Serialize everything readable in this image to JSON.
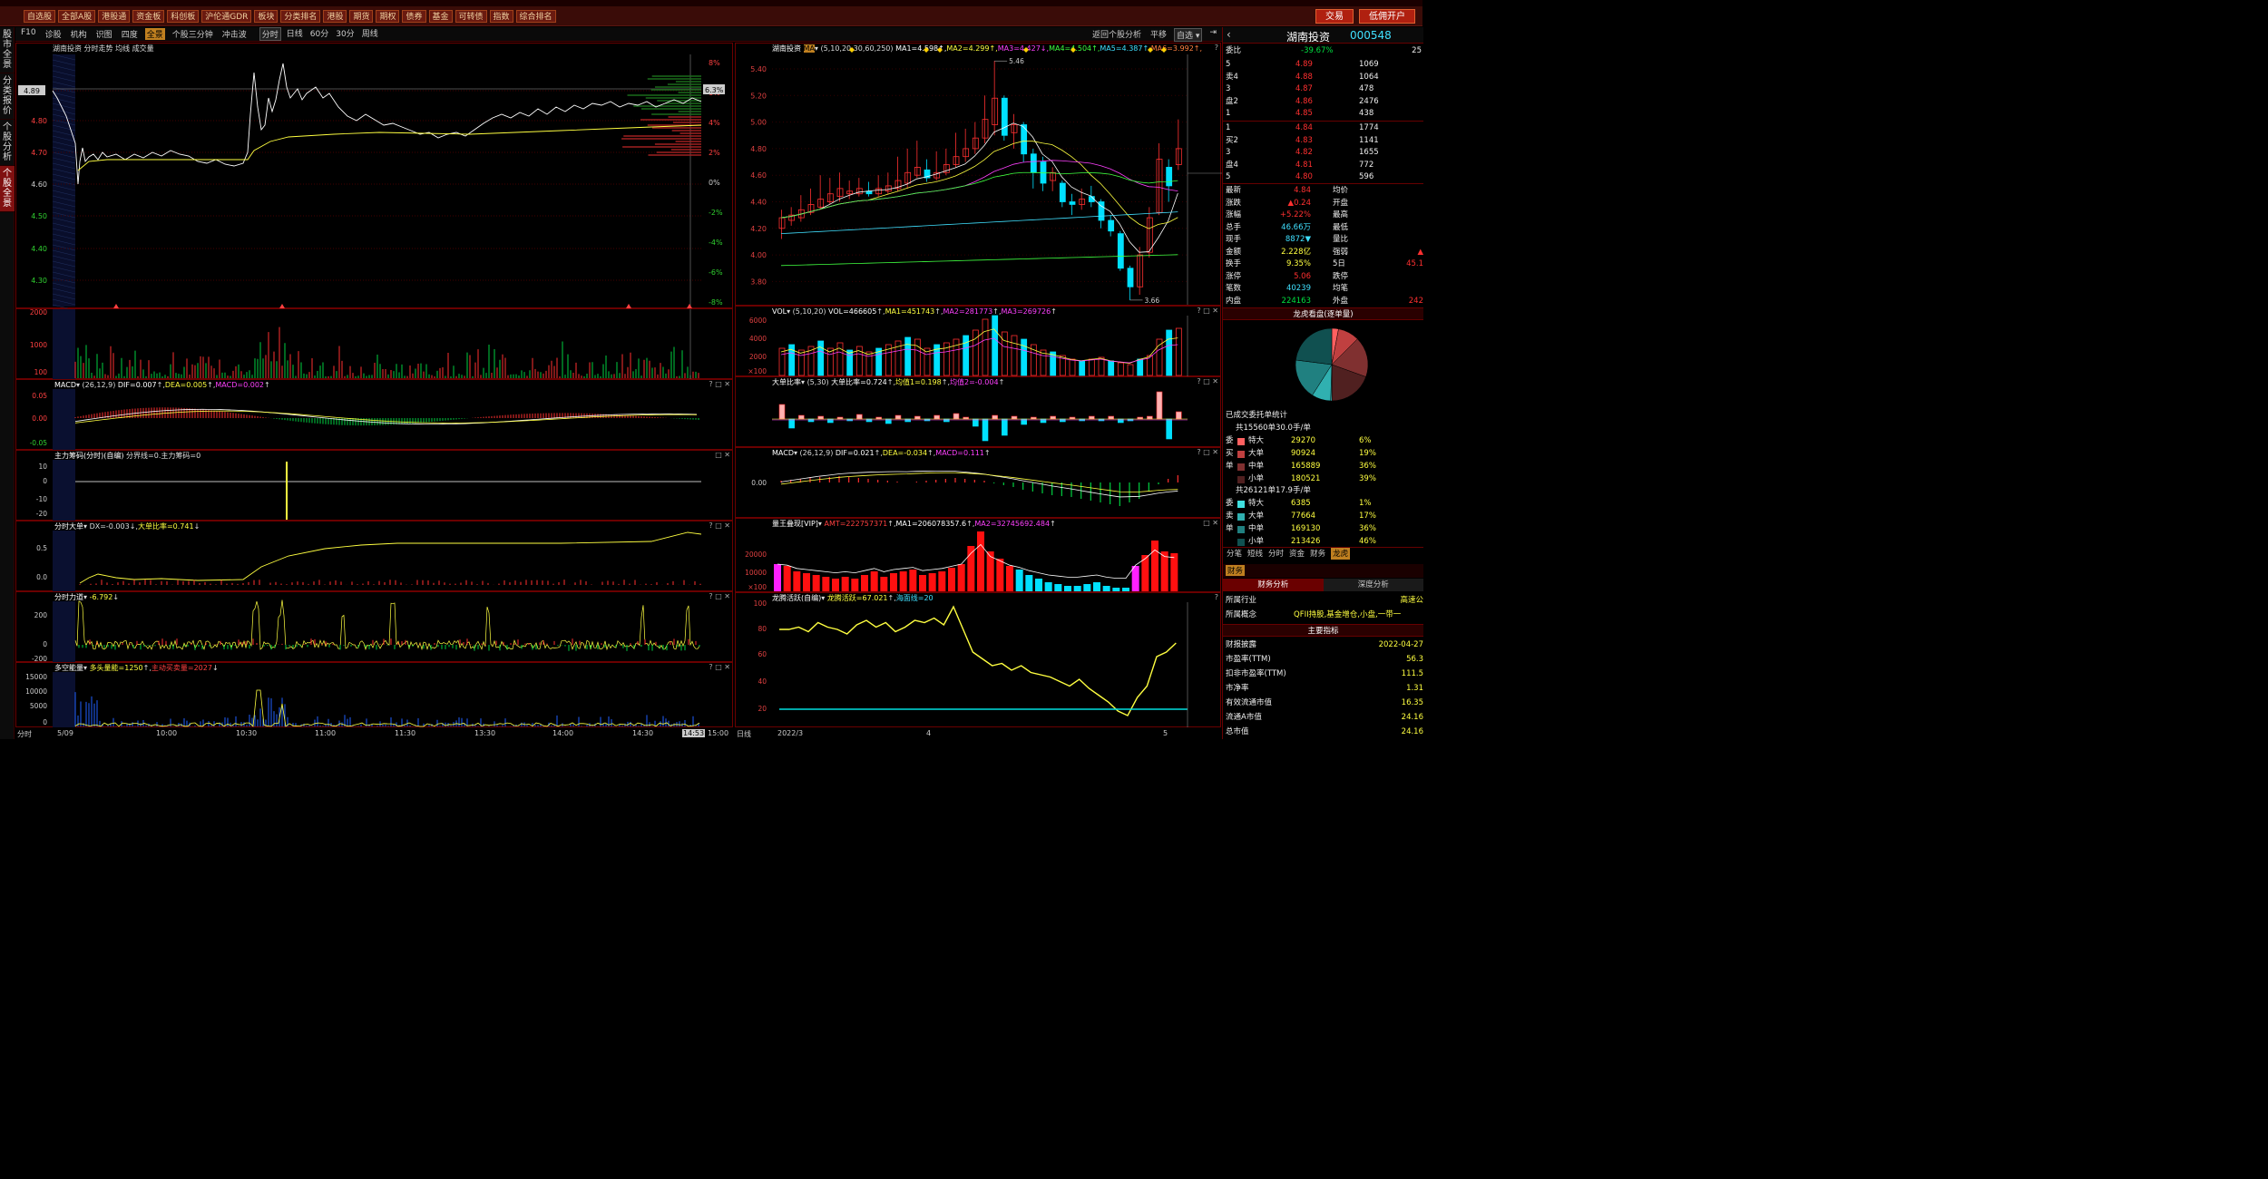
{
  "toolbar": {
    "buttons": [
      "自选股",
      "全部A股",
      "港股通",
      "资金板",
      "科创板",
      "沪伦通GDR",
      "板块",
      "分类排名",
      "港股",
      "期货",
      "期权",
      "债券",
      "基金",
      "可转债",
      "指数",
      "综合排名"
    ],
    "trade_label": "交易",
    "margin_label": "低佣开户"
  },
  "leftnav": {
    "items": [
      "股市全景",
      "分类报价",
      "个股分析",
      "个股全景"
    ]
  },
  "subbar": {
    "items": [
      "F10",
      "诊股",
      "机构",
      "识图",
      "四度",
      "全景",
      "个股三分钟",
      "冲击波"
    ],
    "active": "全景",
    "periods": [
      "分时",
      "日线",
      "60分",
      "30分",
      "周线"
    ],
    "return_label": "返回个股分析",
    "flat_label": "平移",
    "watch_label": "自选"
  },
  "intraday": {
    "header": "湖南投资  分时走势  均线  成交量",
    "price_labels": [
      "4.89",
      "4.80",
      "4.70",
      "4.60",
      "4.50",
      "4.40",
      "4.30"
    ],
    "pct_labels": [
      "8%",
      "6%",
      "4%",
      "2%",
      "0%",
      "-2%",
      "-4%",
      "-6%",
      "-8%"
    ],
    "pct_box": "6.3%",
    "price_box": "4.89",
    "vol_labels": [
      "2000",
      "1000",
      "100"
    ],
    "times": [
      "分时",
      "5/09",
      "10:00",
      "10:30",
      "11:00",
      "11:30",
      "13:30",
      "14:00",
      "14:30",
      "14:53",
      "15:00"
    ]
  },
  "subpanels": {
    "macd": {
      "title": "MACD",
      "params": "(26,12,9)",
      "dif": "DIF=0.007",
      "dea": "DEA=0.005",
      "macd": "MACD=0.002",
      "labels": [
        "0.05",
        "0.00",
        "-0.05"
      ]
    },
    "zhuli": {
      "title": "主力筹码(分时)(自编)",
      "text": "分界线=0.主力筹码=0",
      "labels": [
        "10",
        "0",
        "-10",
        "-20"
      ]
    },
    "dadan": {
      "title": "分时大单",
      "text": "DX=-0.003",
      "text2": "大单比率=0.741",
      "labels": [
        "0.5",
        "0.0"
      ]
    },
    "liliang": {
      "title": "分时力道",
      "text": "-6.792",
      "labels": [
        "200",
        "0",
        "-200"
      ]
    },
    "duokong": {
      "title": "多空能量",
      "text": "多头量能=1250",
      "text2": "主动买卖量=2027",
      "labels": [
        "15000",
        "10000",
        "5000",
        "0"
      ]
    }
  },
  "daily": {
    "header_name": "湖南投资",
    "ma_tag": "MA",
    "ma_params": "(5,10,20,30,60,250)",
    "ma_values": [
      "MA1=4.598",
      "MA2=4.299",
      "MA3=4.427",
      "MA4=4.504",
      "MA5=4.387",
      "MA6=3.992"
    ],
    "price_labels": [
      "5.40",
      "5.20",
      "5.00",
      "4.80",
      "4.60",
      "4.40",
      "4.20",
      "4.00",
      "3.80"
    ],
    "high_mark": "5.46",
    "low_mark": "3.66",
    "dates": [
      "日线",
      "2022/3",
      "4",
      "5"
    ]
  },
  "vol": {
    "title": "VOL",
    "params": "(5,10,20)",
    "text": "VOL=466605",
    "ma1": "MA1=451743",
    "ma2": "MA2=281773",
    "ma3": "MA3=269726",
    "labels": [
      "6000",
      "4000",
      "2000",
      "×100"
    ]
  },
  "dadanbi": {
    "title": "大单比率",
    "params": "(5,30)",
    "text": "大单比率=0.724",
    "t2": "均值1=0.198",
    "t3": "均值2=-0.004"
  },
  "dmacd": {
    "title": "MACD",
    "params": "(26,12,9)",
    "text": "DIF=0.021",
    "t2": "DEA=-0.034",
    "t3": "MACD=0.111"
  },
  "liangwang": {
    "title": "量王叠现[VIP]",
    "t1": "AMT=222757371",
    "t2": "MA1=206078357.6",
    "t3": "MA2=32745692.484",
    "labels": [
      "20000",
      "10000",
      "×100"
    ]
  },
  "longteng": {
    "title": "龙腾活跃(自编)",
    "t1": "龙腾活跃=67.021",
    "t2": "海面线=20",
    "labels": [
      "100",
      "80",
      "60",
      "40",
      "20"
    ]
  },
  "quote": {
    "name": "湖南投资",
    "code": "000548",
    "weibi_label": "委比",
    "weibi": "-39.67%",
    "weicha": "25",
    "asks": [
      {
        "label": "5",
        "price": "4.89",
        "vol": "1069"
      },
      {
        "label": "卖4",
        "price": "4.88",
        "vol": "1064"
      },
      {
        "label": "3",
        "price": "4.87",
        "vol": "478"
      },
      {
        "label": "盘2",
        "price": "4.86",
        "vol": "2476"
      },
      {
        "label": "1",
        "price": "4.85",
        "vol": "438"
      }
    ],
    "bids": [
      {
        "label": "1",
        "price": "4.84",
        "vol": "1774"
      },
      {
        "label": "买2",
        "price": "4.83",
        "vol": "1141"
      },
      {
        "label": "3",
        "price": "4.82",
        "vol": "1655"
      },
      {
        "label": "盘4",
        "price": "4.81",
        "vol": "772"
      },
      {
        "label": "5",
        "price": "4.80",
        "vol": "596"
      }
    ],
    "stats": [
      {
        "l": "最新",
        "v": "4.84",
        "l2": "均价",
        "v2": ""
      },
      {
        "l": "涨跌",
        "v": "▲0.24",
        "l2": "开盘",
        "v2": ""
      },
      {
        "l": "涨幅",
        "v": "+5.22%",
        "l2": "最高",
        "v2": ""
      },
      {
        "l": "总手",
        "v": "46.66万",
        "l2": "最低",
        "v2": ""
      },
      {
        "l": "现手",
        "v": "8872▼",
        "l2": "量比",
        "v2": ""
      },
      {
        "l": "金额",
        "v": "2.228亿",
        "l2": "强弱",
        "v2": "▲"
      },
      {
        "l": "换手",
        "v": "9.35%",
        "l2": "5日",
        "v2": "45.1"
      },
      {
        "l": "涨停",
        "v": "5.06",
        "l2": "跌停",
        "v2": ""
      },
      {
        "l": "笔数",
        "v": "40239",
        "l2": "均笔",
        "v2": ""
      },
      {
        "l": "内盘",
        "v": "224163",
        "l2": "外盘",
        "v2": "242"
      }
    ],
    "pie_title": "龙虎看盘(逐单量)",
    "deal_title": "已成交委托单统计",
    "buy_total": "共15560单30.0手/单",
    "buy_rows": [
      {
        "side": "委",
        "t": "特大",
        "v": "29270",
        "p": "6%"
      },
      {
        "side": "买",
        "t": "大单",
        "v": "90924",
        "p": "19%"
      },
      {
        "side": "单",
        "t": "中单",
        "v": "165889",
        "p": "36%"
      },
      {
        "side": "",
        "t": "小单",
        "v": "180521",
        "p": "39%"
      }
    ],
    "sell_total": "共26121单17.9手/单",
    "sell_rows": [
      {
        "side": "委",
        "t": "特大",
        "v": "6385",
        "p": "1%"
      },
      {
        "side": "卖",
        "t": "大单",
        "v": "77664",
        "p": "17%"
      },
      {
        "side": "单",
        "t": "中单",
        "v": "169130",
        "p": "36%"
      },
      {
        "side": "",
        "t": "小单",
        "v": "213426",
        "p": "46%"
      }
    ],
    "tabs": [
      "分笔",
      "短线",
      "分时",
      "资金",
      "财务",
      "龙虎"
    ],
    "tab_active": "龙虎",
    "fin_tab": "财务",
    "fin_sub": [
      "财务分析",
      "深度分析"
    ],
    "industry_label": "所属行业",
    "industry": "高速公",
    "concept_label": "所属概念",
    "concept": "QFII持股,基金增仓,小盘,一带一",
    "main_title": "主要指标",
    "fin_rows": [
      {
        "l": "财报披露",
        "v": "2022-04-27"
      },
      {
        "l": "市盈率(TTM)",
        "v": "56.3"
      },
      {
        "l": "扣非市盈率(TTM)",
        "v": "111.5"
      },
      {
        "l": "市净率",
        "v": "1.31"
      },
      {
        "l": "有效流通市值",
        "v": "16.35"
      },
      {
        "l": "流通A市值",
        "v": "24.16"
      },
      {
        "l": "总市值",
        "v": "24.16"
      }
    ]
  }
}
